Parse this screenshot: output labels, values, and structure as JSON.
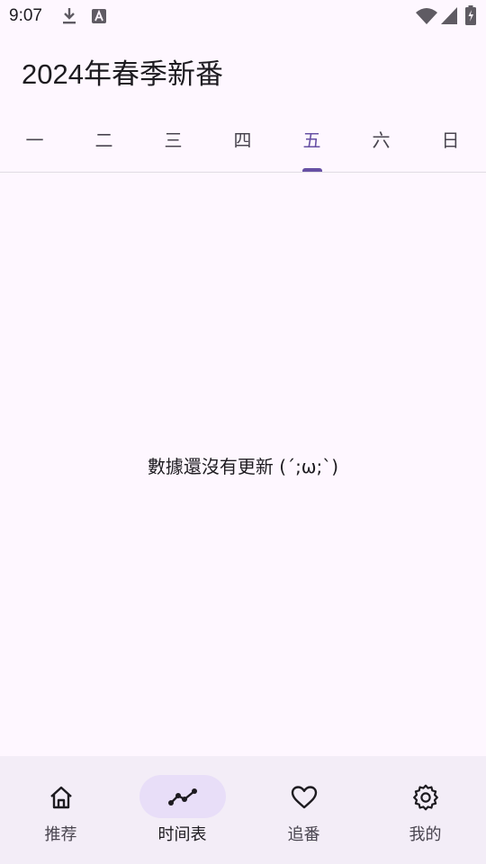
{
  "status_bar": {
    "time": "9:07",
    "icons": [
      "download-icon",
      "text-a-icon",
      "wifi-icon",
      "signal-icon",
      "battery-icon"
    ]
  },
  "header": {
    "title": "2024年春季新番"
  },
  "tabs": {
    "items": [
      {
        "label": "一",
        "active": false
      },
      {
        "label": "二",
        "active": false
      },
      {
        "label": "三",
        "active": false
      },
      {
        "label": "四",
        "active": false
      },
      {
        "label": "五",
        "active": true
      },
      {
        "label": "六",
        "active": false
      },
      {
        "label": "日",
        "active": false
      }
    ]
  },
  "content": {
    "empty_message": "數據還沒有更新 (´;ω;`)"
  },
  "bottom_nav": {
    "items": [
      {
        "label": "推荐",
        "icon": "home-icon",
        "active": false
      },
      {
        "label": "时间表",
        "icon": "timeline-icon",
        "active": true
      },
      {
        "label": "追番",
        "icon": "heart-icon",
        "active": false
      },
      {
        "label": "我的",
        "icon": "gear-icon",
        "active": false
      }
    ]
  },
  "colors": {
    "background": "#fef7ff",
    "accent": "#6750a4",
    "nav_background": "#f3edf7",
    "active_pill": "#e8def8",
    "text_primary": "#1d1b20",
    "text_secondary": "#49454f"
  }
}
